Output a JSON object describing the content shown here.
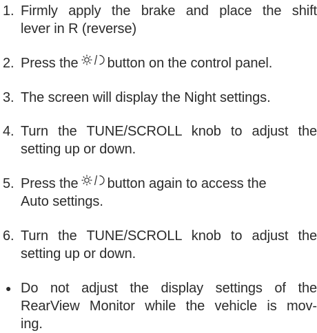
{
  "steps": [
    {
      "number": "1.",
      "lines": [
        "Firmly apply the brake and place the shift",
        "lever in R (reverse)"
      ]
    },
    {
      "number": "2.",
      "before": "Press the",
      "icon": "day-night-icon",
      "after": "button on the control panel."
    },
    {
      "number": "3.",
      "lines": [
        "The screen will display the Night settings."
      ]
    },
    {
      "number": "4.",
      "lines": [
        "Turn the TUNE/SCROLL knob to adjust the",
        "setting up or down."
      ]
    },
    {
      "number": "5.",
      "before": "Press the",
      "icon": "day-night-icon",
      "after": "button again to access the",
      "line2": "Auto settings."
    },
    {
      "number": "6.",
      "lines": [
        "Turn the TUNE/SCROLL knob to adjust the",
        "setting up or down."
      ]
    }
  ],
  "note": {
    "bullet": "●",
    "lines": [
      "Do not adjust the display settings of the",
      "RearView Monitor while the vehicle is mov-",
      "ing."
    ]
  }
}
